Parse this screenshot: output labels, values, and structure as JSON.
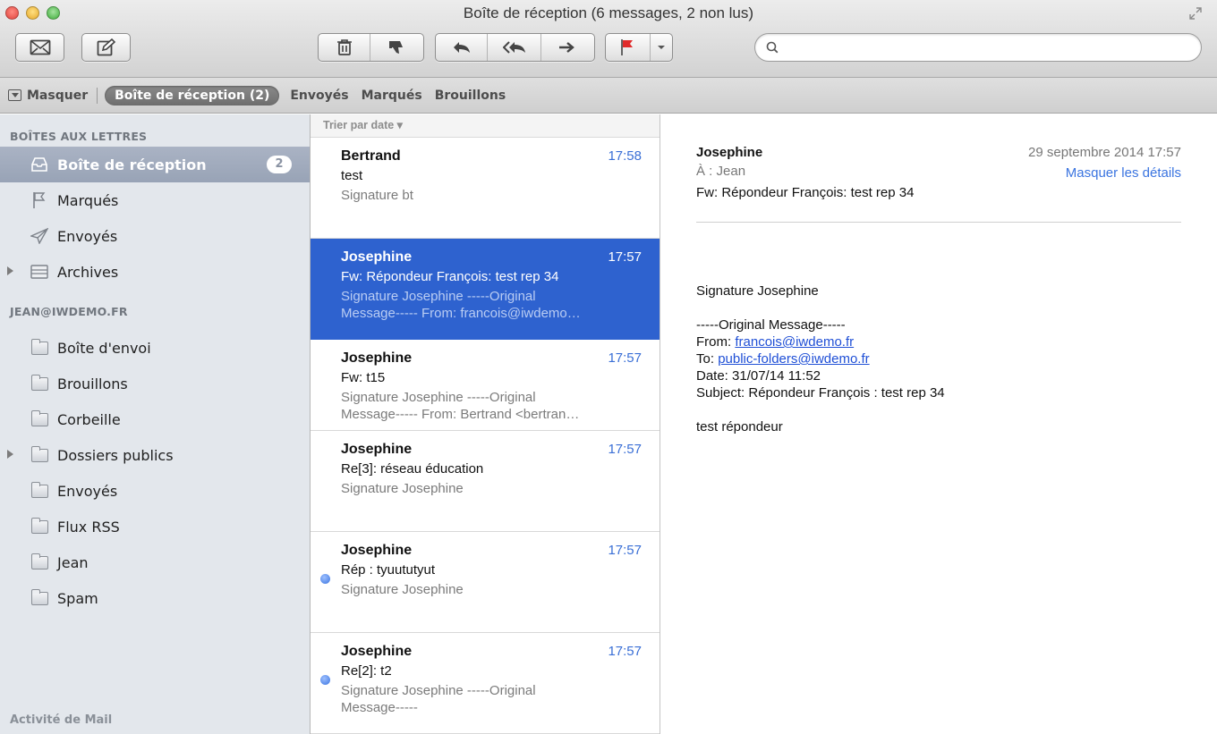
{
  "window": {
    "title": "Boîte de réception (6 messages, 2 non lus)"
  },
  "search": {
    "placeholder": "",
    "value": ""
  },
  "favorites": {
    "hide_label": "Masquer",
    "selected": "Boîte de réception (2)",
    "items": [
      "Envoyés",
      "Marqués",
      "Brouillons"
    ]
  },
  "sidebar": {
    "section_mailboxes": "BOÎTES AUX LETTRES",
    "mailboxes": [
      {
        "label": "Boîte de réception",
        "badge": "2",
        "icon": "inbox-icon"
      },
      {
        "label": "Marqués",
        "icon": "flag-icon"
      },
      {
        "label": "Envoyés",
        "icon": "paper-plane-icon"
      },
      {
        "label": "Archives",
        "icon": "archive-icon"
      }
    ],
    "section_account": "JEAN@IWDEMO.FR",
    "folders": [
      "Boîte d'envoi",
      "Brouillons",
      "Corbeille",
      "Dossiers publics",
      "Envoyés",
      "Flux RSS",
      "Jean",
      "Spam"
    ],
    "footer": "Activité de Mail"
  },
  "list": {
    "sort_label": "Trier par date ▾",
    "messages": [
      {
        "sender": "Bertrand",
        "time": "17:58",
        "subject": "test",
        "preview1": "Signature bt",
        "preview2": ""
      },
      {
        "sender": "Josephine",
        "time": "17:57",
        "subject": "Fw: Répondeur François: test rep 34",
        "preview1": "Signature Josephine -----Original",
        "preview2": "Message----- From: francois@iwdemo…"
      },
      {
        "sender": "Josephine",
        "time": "17:57",
        "subject": "Fw: t15",
        "preview1": "Signature Josephine -----Original",
        "preview2": "Message----- From: Bertrand <bertran…"
      },
      {
        "sender": "Josephine",
        "time": "17:57",
        "subject": "Re[3]: réseau éducation",
        "preview1": "Signature Josephine",
        "preview2": ""
      },
      {
        "sender": "Josephine",
        "time": "17:57",
        "subject": "Rép : tyuututyut",
        "preview1": "Signature Josephine",
        "preview2": ""
      },
      {
        "sender": "Josephine",
        "time": "17:57",
        "subject": "Re[2]: t2",
        "preview1": "Signature Josephine -----Original",
        "preview2": "Message-----"
      }
    ]
  },
  "reader": {
    "from": "Josephine",
    "date": "29 septembre 2014 17:57",
    "to": "À :  Jean",
    "hide_details": "Masquer les détails",
    "subject": "Fw: Répondeur François: test rep 34",
    "signature": "Signature Josephine",
    "original_header": "-----Original Message-----",
    "from_label": "From: ",
    "from_email": "francois@iwdemo.fr",
    "to_label": "To: ",
    "to_email": "public-folders@iwdemo.fr",
    "date_line": "Date: 31/07/14 11:52",
    "subject_line": "Subject: Répondeur François : test rep 34",
    "body_text": "test répondeur"
  },
  "colors": {
    "selection_blue": "#2e62cf",
    "time_blue": "#3a6fd6",
    "sidebar_bg": "#e3e7ec"
  }
}
